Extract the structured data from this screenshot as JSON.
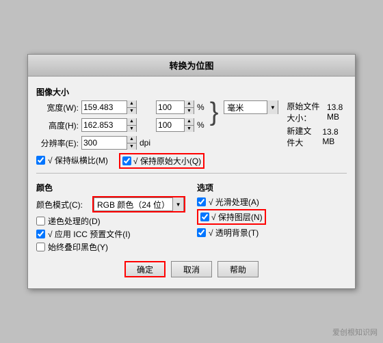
{
  "dialog": {
    "title": "转换为位图",
    "sections": {
      "image_size": {
        "label": "图像大小",
        "width_label": "宽度(W):",
        "width_value": "159.483",
        "height_label": "高度(H):",
        "height_value": "162.853",
        "resolution_label": "分辨率(E):",
        "resolution_value": "300",
        "resolution_unit": "dpi",
        "percent_width": "100",
        "percent_height": "100",
        "percent_symbol": "%",
        "unit": "毫米",
        "keep_ratio_label": "√ 保持纵横比(M)",
        "keep_original_label": "√ 保持原始大小(Q)",
        "original_size_label": "原始文件大小：",
        "original_size_value": "13.8 MB",
        "new_size_label": "新建文件大",
        "new_size_value": "13.8 MB"
      },
      "color": {
        "label": "颜色",
        "color_mode_label": "颜色模式(C):",
        "color_mode_value": "RGB 颜色（24 位）",
        "color_handle_label": "递色处理的(D)",
        "apply_icc_label": "√ 应用 ICC 预置文件(I)",
        "always_overprint_label": "始终叠印黑色(Y)"
      },
      "options": {
        "label": "选项",
        "anti_aliasing_label": "√ 光滑处理(A)",
        "keep_layers_label": "√ 保持图层(N)",
        "transparent_bg_label": "√ 透明背景(T)"
      }
    },
    "buttons": {
      "ok": "确定",
      "cancel": "取消",
      "help": "帮助"
    }
  },
  "watermark": "爱创根知识网"
}
